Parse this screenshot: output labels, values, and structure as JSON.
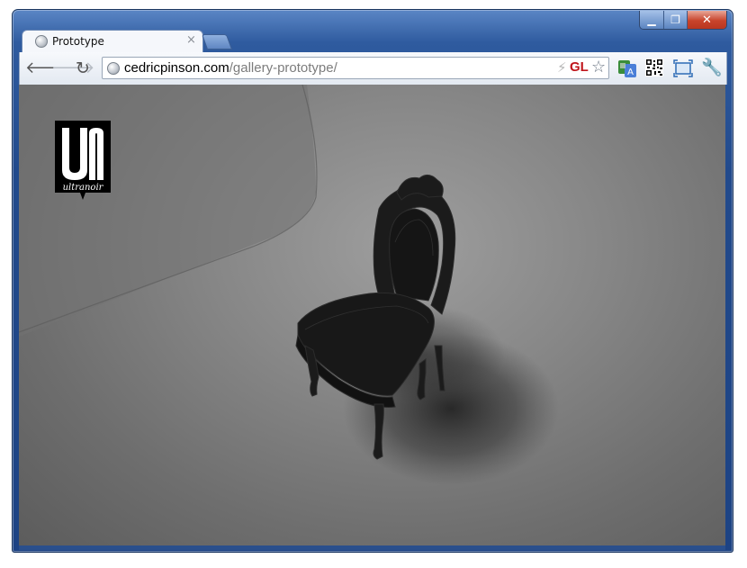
{
  "tab": {
    "title": "Prototype",
    "close": "×"
  },
  "caption": {
    "minimize": "▁",
    "maximize": "❐",
    "close": "✕"
  },
  "toolbar": {
    "back": "🡐",
    "forward": "🡒",
    "reload": "↻",
    "url_host": "cedricpinson.com",
    "url_path": "/gallery-prototype/",
    "bolt": "⚡",
    "gl_badge": "GL",
    "star": "☆",
    "wrench": "🔧"
  },
  "content": {
    "logo_text": "ultranoir",
    "logo_mark": "UN"
  },
  "colors": {
    "frame": "#224a8c",
    "gl_red": "#c0161c",
    "scene_bg": "#878787"
  },
  "icons": {
    "tab_favicon": "globe-icon",
    "omnibox_favicon": "globe-icon",
    "translate": "translate-icon",
    "qr": "qr-code-icon",
    "fullscreen": "fullscreen-icon",
    "settings": "wrench-icon"
  }
}
